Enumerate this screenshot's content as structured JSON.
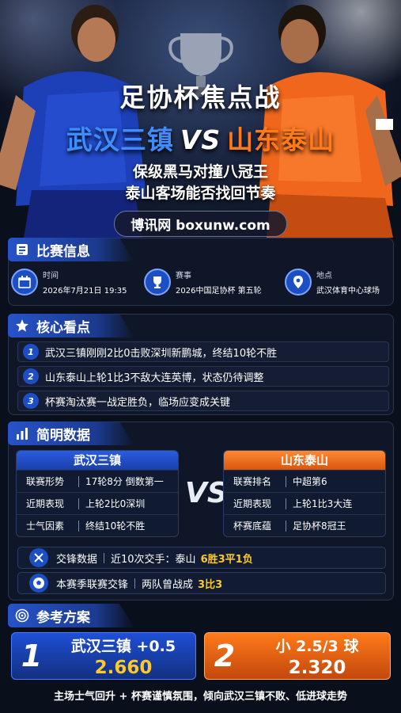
{
  "hero": {
    "title": "足协杯焦点战",
    "team_a": "武汉三镇",
    "vs": "VS",
    "team_b": "山东泰山",
    "subtitle_1": "保级黑马对撞八冠王",
    "subtitle_2": "泰山客场能否找回节奏",
    "brand": "博讯网 boxunw.com"
  },
  "match_info": {
    "heading": "比赛信息",
    "time_label": "时间",
    "time_value": "2026年7月21日 19:35",
    "event_label": "赛事",
    "event_value": "2026中国足协杯 第五轮",
    "venue_label": "地点",
    "venue_value": "武汉体育中心球场"
  },
  "highlights": {
    "heading": "核心看点",
    "items": [
      {
        "n": "1",
        "text": "武汉三镇刚刚2比0击败深圳新鹏城，终结10轮不胜"
      },
      {
        "n": "2",
        "text": "山东泰山上轮1比3不敌大连英博，状态仍待调整"
      },
      {
        "n": "3",
        "text": "杯赛淘汰赛一战定胜负，临场应变成关键"
      }
    ]
  },
  "data_section": {
    "heading": "简明数据",
    "vs": "VS",
    "team_a": {
      "name": "武汉三镇",
      "rows": [
        {
          "k": "联赛形势",
          "v": "17轮8分 倒数第一"
        },
        {
          "k": "近期表现",
          "v": "上轮2比0深圳"
        },
        {
          "k": "士气因素",
          "v": "终结10轮不胜"
        }
      ]
    },
    "team_b": {
      "name": "山东泰山",
      "rows": [
        {
          "k": "联赛排名",
          "v": "中超第6"
        },
        {
          "k": "近期表现",
          "v": "上轮1比3大连"
        },
        {
          "k": "杯赛底蕴",
          "v": "足协杯8冠王"
        }
      ]
    },
    "h2h_1": {
      "label": "交锋数据",
      "text": "近10次交手：泰山",
      "highlight": "6胜3平1负"
    },
    "h2h_2": {
      "label": "本赛季联赛交锋",
      "text": "两队曾战成",
      "highlight": "3比3"
    }
  },
  "plan": {
    "heading": "参考方案",
    "pick_1": {
      "n": "1",
      "title": "武汉三镇 +0.5",
      "odds": "2.660"
    },
    "pick_2": {
      "n": "2",
      "title": "小 2.5/3 球",
      "odds": "2.320"
    },
    "footer": "主场士气回升 + 杯赛谨慎氛围，倾向武汉三镇不败、低进球走势"
  },
  "colors": {
    "blue": "#1d4fc4",
    "orange": "#ff7a1a",
    "gold": "#ffc928",
    "bg": "#0a0f1c"
  }
}
